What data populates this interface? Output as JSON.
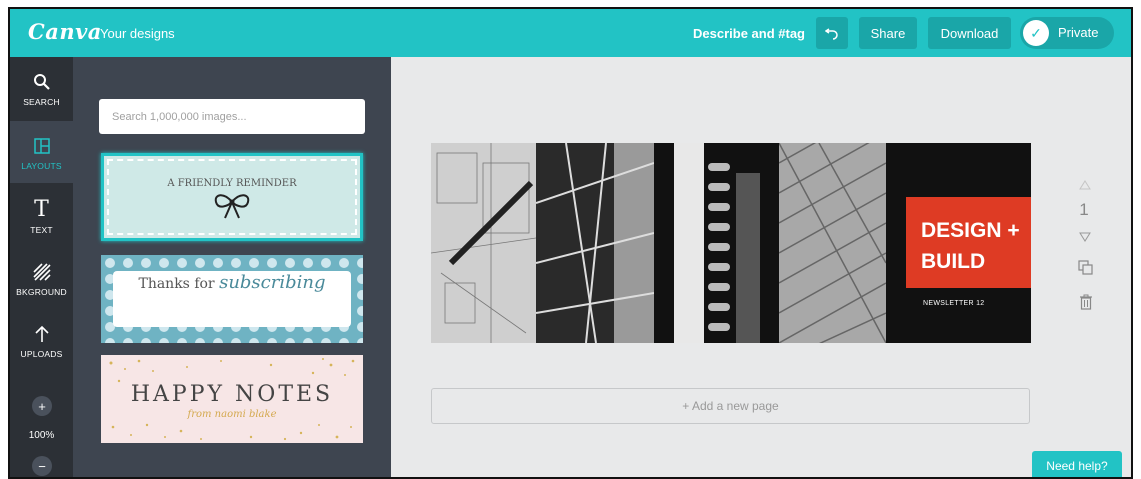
{
  "header": {
    "logo": "Canva",
    "your_designs": "Your designs",
    "describe": "Describe and #tag",
    "share": "Share",
    "download": "Download",
    "private": "Private"
  },
  "rail": {
    "items": [
      {
        "label": "SEARCH",
        "icon": "search-icon"
      },
      {
        "label": "LAYOUTS",
        "icon": "layouts-icon"
      },
      {
        "label": "TEXT",
        "icon": "text-icon"
      },
      {
        "label": "BKGROUND",
        "icon": "background-icon"
      },
      {
        "label": "UPLOADS",
        "icon": "upload-icon"
      }
    ],
    "zoom": "100%"
  },
  "panel": {
    "search_placeholder": "Search 1,000,000 images...",
    "templates": [
      {
        "title": "A FRIENDLY REMINDER"
      },
      {
        "text_a": "Thanks for",
        "text_b": "subscribing"
      },
      {
        "title": "HAPPY NOTES",
        "subtitle": "from naomi blake"
      }
    ]
  },
  "canvas": {
    "design_title": "DESIGN + BUILD",
    "newsletter": "NEWSLETTER 12",
    "page_number": "1",
    "add_page": "+ Add a new page"
  },
  "help": "Need help?",
  "colors": {
    "accent": "#22c3c5",
    "rail": "#2c3036",
    "panel": "#3e4550",
    "design_red": "#de3b24"
  }
}
